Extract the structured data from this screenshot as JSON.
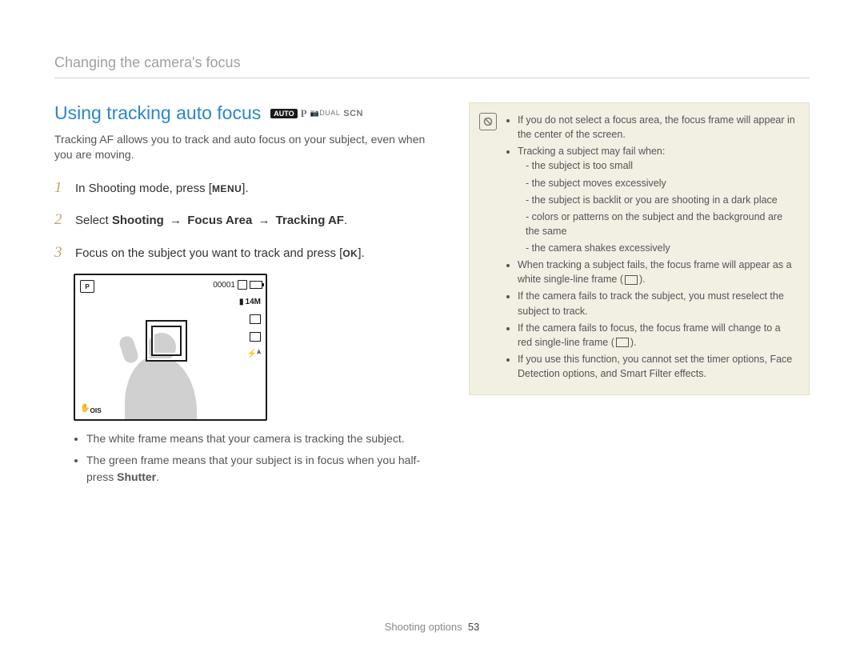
{
  "running_head": "Changing the camera's focus",
  "section": {
    "title": "Using tracking auto focus",
    "modes": {
      "auto": "AUTO",
      "p": "P",
      "dual": "DUAL",
      "scn": "SCN"
    },
    "intro": "Tracking AF allows you to track and auto focus on your subject, even when you are moving."
  },
  "steps": [
    {
      "num": "1",
      "pre": "In Shooting mode, press [",
      "key": "MENU",
      "post": "]."
    },
    {
      "num": "2",
      "text_parts": [
        "Select ",
        "Shooting",
        " → ",
        "Focus Area",
        " → ",
        "Tracking AF",
        "."
      ]
    },
    {
      "num": "3",
      "pre": "Focus on the subject you want to track and press [",
      "key": "OK",
      "post": "]."
    }
  ],
  "lcd": {
    "top_left": "P",
    "top_right_counter": "00001",
    "right_icons": [
      "14M",
      "photo-size",
      "drive-mode",
      "flash-auto"
    ],
    "bottom_left": "OIS"
  },
  "sub_bullets": [
    "The white frame means that your camera is tracking the subject.",
    [
      "The green frame means that your subject is in focus when you half-press ",
      "Shutter",
      "."
    ]
  ],
  "notes": {
    "items": [
      "If you do not select a focus area, the focus frame will appear in the center of the screen.",
      {
        "lead": "Tracking a subject may fail when:",
        "sub": [
          "the subject is too small",
          "the subject moves excessively",
          "the subject is backlit or you are shooting in a dark place",
          "colors or patterns on the subject and the background are the same",
          "the camera shakes excessively"
        ]
      },
      {
        "frame_line": [
          "When tracking a subject fails, the focus frame will appear as a white single-line frame (",
          ")."
        ]
      },
      "If the camera fails to track the subject, you must reselect the subject to track.",
      {
        "frame_line": [
          "If the camera fails to focus, the focus frame will change to a red single-line frame (",
          ")."
        ]
      },
      "If you use this function, you cannot set the timer options, Face Detection options, and Smart Filter effects."
    ]
  },
  "footer": {
    "label": "Shooting options",
    "page": "53"
  }
}
